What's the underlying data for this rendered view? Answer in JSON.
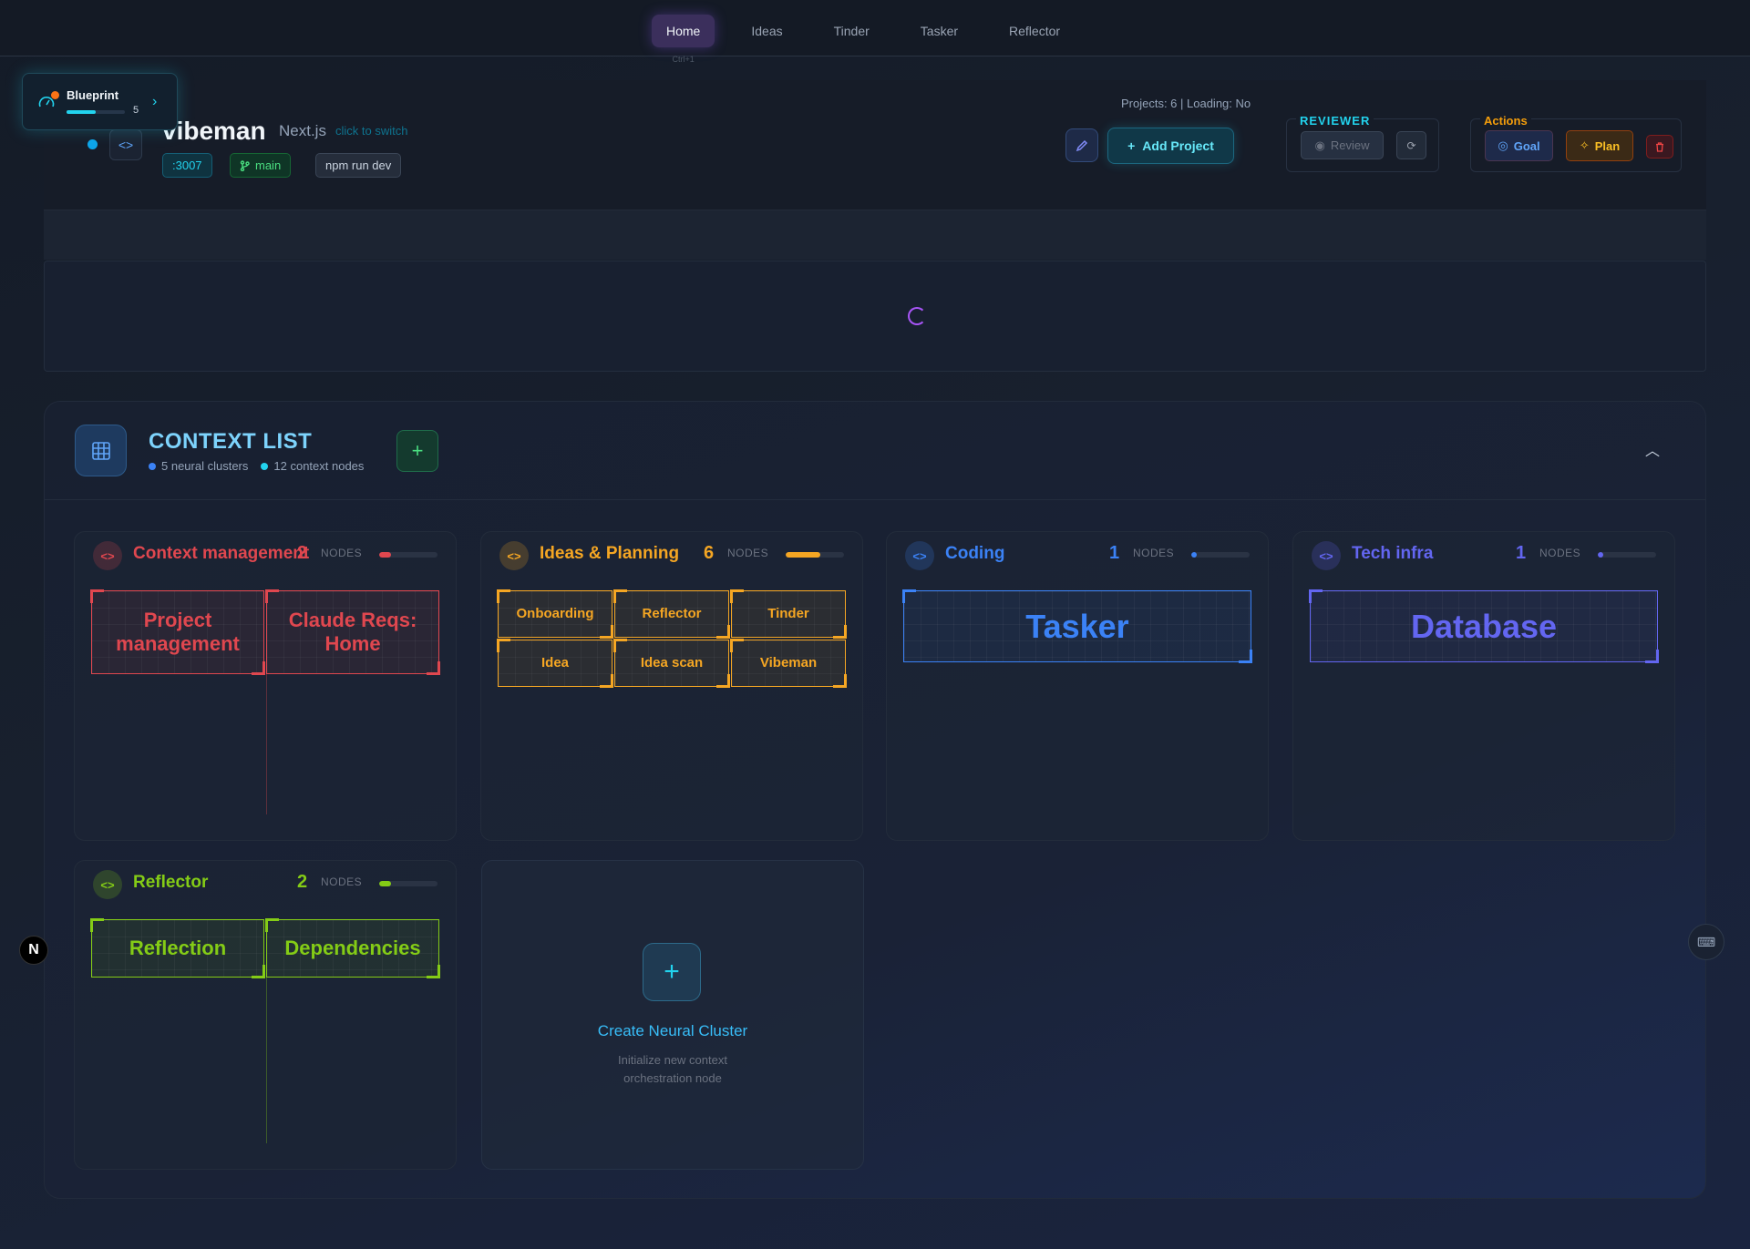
{
  "nav": {
    "tabs": [
      {
        "label": "Home",
        "hint": "Ctrl+1",
        "active": true
      },
      {
        "label": "Ideas"
      },
      {
        "label": "Tinder"
      },
      {
        "label": "Tasker"
      },
      {
        "label": "Reflector"
      }
    ]
  },
  "blueprint": {
    "title": "Blueprint",
    "count": "5",
    "progress": 0.5
  },
  "project": {
    "name": "vibeman",
    "framework": "Next.js",
    "switch_hint": "click to switch",
    "port": ":3007",
    "branch": "main",
    "command": "npm run dev",
    "stats": "Projects: 6 | Loading: No",
    "add_label": "Add Project"
  },
  "reviewer": {
    "label": "REVIEWER",
    "review_label": "Review"
  },
  "actions": {
    "label": "Actions",
    "goal_label": "Goal",
    "plan_label": "Plan"
  },
  "context_list": {
    "title": "CONTEXT LIST",
    "clusters_text": "5 neural clusters",
    "nodes_text": "12 context nodes",
    "nodes_label": "NODES",
    "clusters": [
      {
        "name": "Context management",
        "count": "2",
        "fill": 0.2,
        "color": "#e0474f",
        "nodes": [
          "Project management",
          "Claude Reqs: Home"
        ]
      },
      {
        "name": "Ideas & Planning",
        "count": "6",
        "fill": 0.6,
        "color": "#f5a623",
        "nodes": [
          "Onboarding",
          "Reflector",
          "Tinder",
          "Idea",
          "Idea scan",
          "Vibeman"
        ]
      },
      {
        "name": "Coding",
        "count": "1",
        "fill": 0.1,
        "color": "#3b82f6",
        "nodes": [
          "Tasker"
        ]
      },
      {
        "name": "Tech infra",
        "count": "1",
        "fill": 0.1,
        "color": "#6366f1",
        "nodes": [
          "Database"
        ]
      },
      {
        "name": "Reflector",
        "count": "2",
        "fill": 0.2,
        "color": "#84cc16",
        "nodes": [
          "Reflection",
          "Dependencies"
        ]
      }
    ],
    "create": {
      "title": "Create Neural Cluster",
      "subtitle": "Initialize new context orchestration node"
    }
  },
  "nextjs_badge": "N"
}
